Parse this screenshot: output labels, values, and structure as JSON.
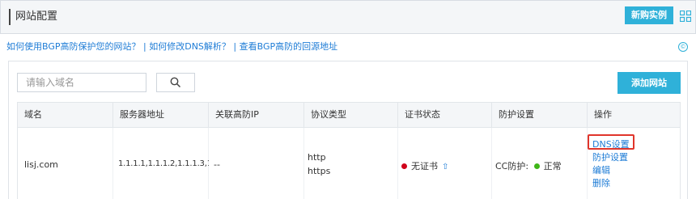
{
  "header": {
    "title": "网站配置",
    "new_instance_label": "新购实例",
    "grid_icon": "grid-icon"
  },
  "help_links": [
    "如何使用BGP高防保护您的网站？",
    "如何修改DNS解析？",
    "查看BGP高防的回源地址"
  ],
  "help_separator": "|",
  "info_icon": "info-icon",
  "search": {
    "placeholder": "请输入域名",
    "value": "",
    "icon": "search-icon"
  },
  "add_site_label": "添加网站",
  "table": {
    "columns": [
      "域名",
      "服务器地址",
      "关联高防IP",
      "协议类型",
      "证书状态",
      "防护设置",
      "操作"
    ],
    "rows": [
      {
        "domain": "lisj.com",
        "server_address": "1.1.1.1,1.1.1.2,1.1.1.3,1.1",
        "associated_ip": "--",
        "protocols": [
          "http",
          "https"
        ],
        "cert_status": "无证书",
        "cert_status_color": "#d0021b",
        "protection_label": "CC防护:",
        "protection_status": "正常",
        "protection_status_color": "#3fb618",
        "actions": [
          "DNS设置",
          "防护设置",
          "编辑",
          "删除"
        ]
      }
    ]
  },
  "colors": {
    "accent": "#2fb1d9",
    "link": "#1e7cd6",
    "highlight_border": "#e0352b"
  }
}
